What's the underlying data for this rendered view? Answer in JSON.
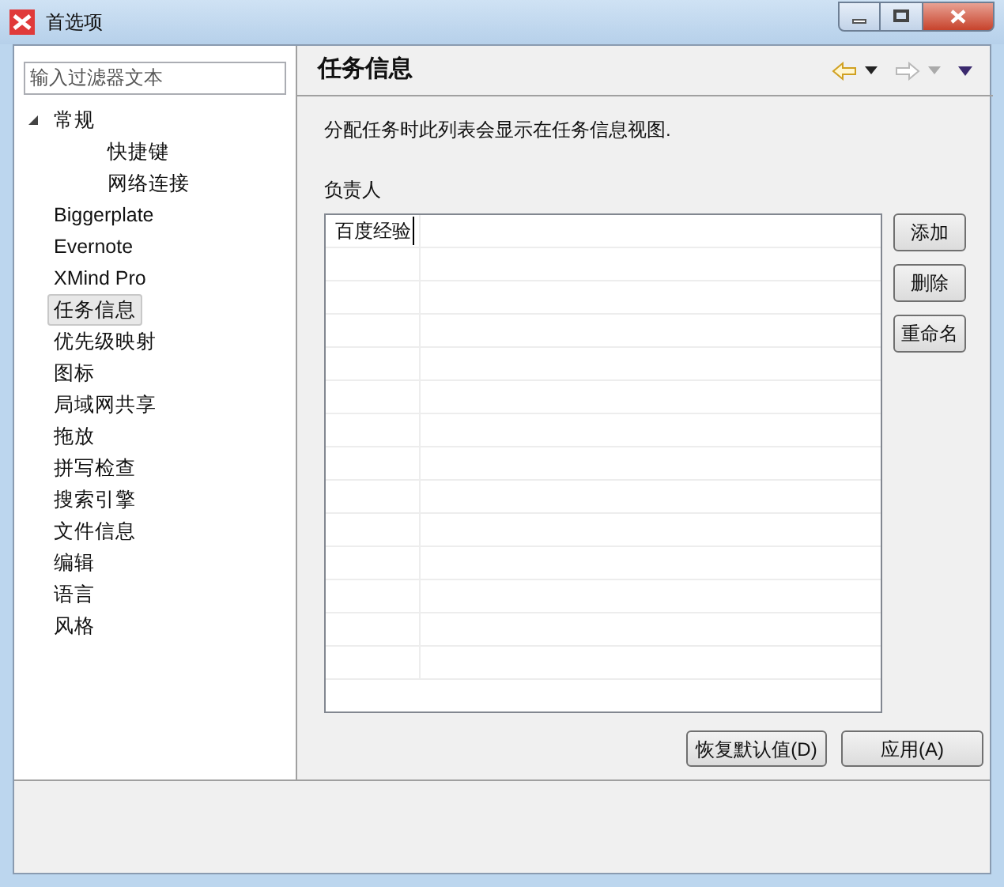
{
  "window": {
    "title": "首选项"
  },
  "filter": {
    "placeholder": "输入过滤器文本"
  },
  "tree": [
    {
      "label": "常规",
      "expanded": true,
      "selected": false,
      "children": [
        {
          "label": "快捷键",
          "selected": false
        },
        {
          "label": "网络连接",
          "selected": false
        }
      ]
    },
    {
      "label": "Biggerplate",
      "selected": false
    },
    {
      "label": "Evernote",
      "selected": false
    },
    {
      "label": "XMind Pro",
      "selected": false
    },
    {
      "label": "任务信息",
      "selected": true
    },
    {
      "label": "优先级映射",
      "selected": false
    },
    {
      "label": "图标",
      "selected": false
    },
    {
      "label": "局域网共享",
      "selected": false
    },
    {
      "label": "拖放",
      "selected": false
    },
    {
      "label": "拼写检查",
      "selected": false
    },
    {
      "label": "搜索引擎",
      "selected": false
    },
    {
      "label": "文件信息",
      "selected": false
    },
    {
      "label": "编辑",
      "selected": false
    },
    {
      "label": "语言",
      "selected": false
    },
    {
      "label": "风格",
      "selected": false
    }
  ],
  "page": {
    "title": "任务信息",
    "description": "分配任务时此列表会显示在任务信息视图.",
    "list_label": "负责人",
    "rows": [
      "百度经验"
    ],
    "side_buttons": [
      "添加",
      "删除",
      "重命名"
    ],
    "buttons": [
      "恢复默认值(D)",
      "应用(A)"
    ]
  }
}
